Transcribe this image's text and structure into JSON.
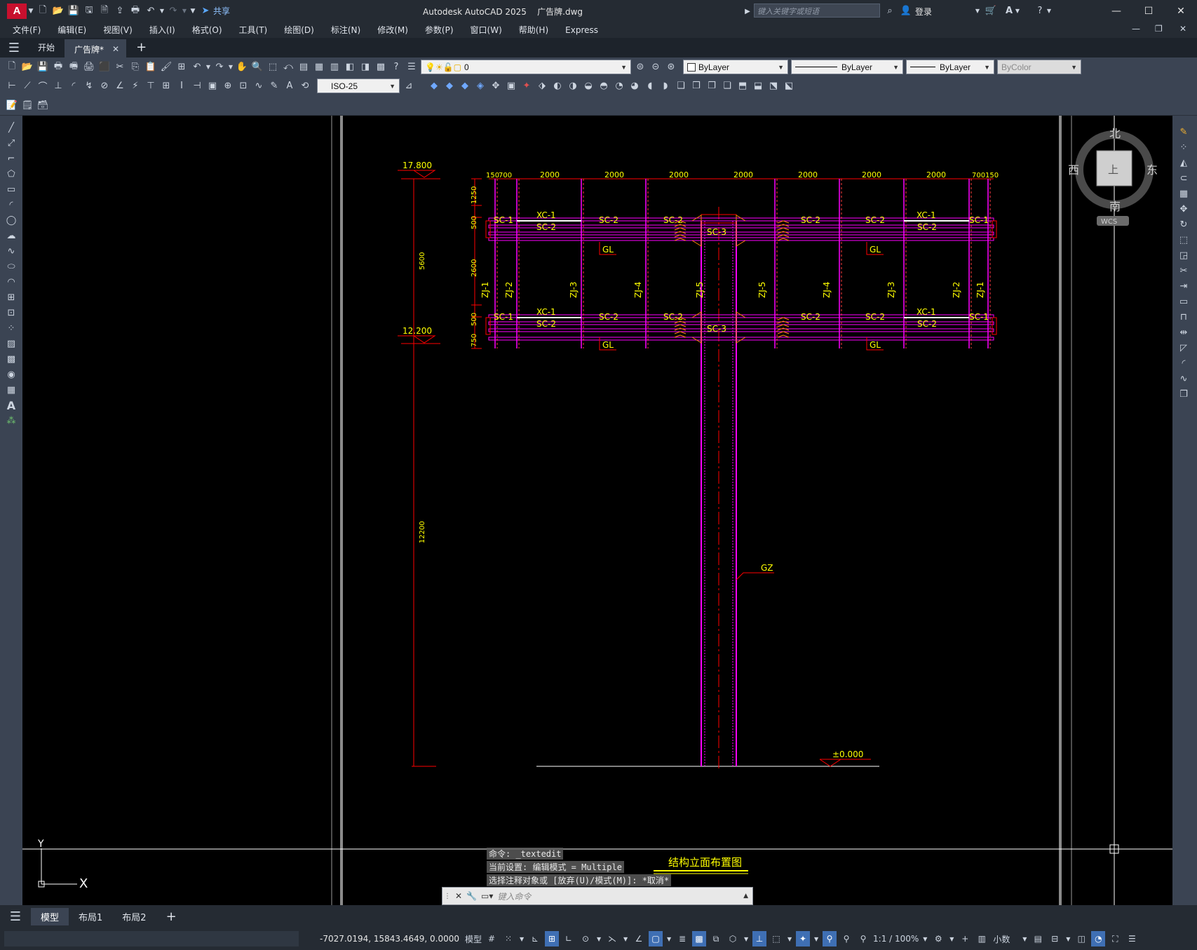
{
  "titlebar": {
    "app_logo": "A",
    "share": "共享",
    "title": "Autodesk AutoCAD 2025    广告牌.dwg",
    "search_placeholder": "键入关键字或短语",
    "login": "登录"
  },
  "menu": [
    "文件(F)",
    "编辑(E)",
    "视图(V)",
    "插入(I)",
    "格式(O)",
    "工具(T)",
    "绘图(D)",
    "标注(N)",
    "修改(M)",
    "参数(P)",
    "窗口(W)",
    "帮助(H)",
    "Express"
  ],
  "tabs": {
    "start": "开始",
    "file": "广告牌*",
    "add": "+"
  },
  "toolbars": {
    "layer": "0",
    "color": "ByLayer",
    "linetype": "ByLayer",
    "lineweight": "ByLayer",
    "plotstyle": "ByColor",
    "dimstyle": "ISO-25"
  },
  "viewcube": {
    "north": "北",
    "south": "南",
    "east": "东",
    "west": "西",
    "face": "上",
    "wcs": "WCS"
  },
  "drawing": {
    "elev_top": "17.800",
    "elev_mid": "12.200",
    "elev_ground": "±0.000",
    "dims_top": [
      "150",
      "700",
      "2000",
      "2000",
      "2000",
      "2000",
      "2000",
      "2000",
      "2000",
      "700",
      "150"
    ],
    "dims_left": [
      "1250",
      "500",
      "2600",
      "500",
      "750"
    ],
    "dims_far_left": [
      "5600",
      "12200"
    ],
    "sc1": "SC-1",
    "sc2": "SC-2",
    "sc3": "SC-3",
    "xc1": "XC-1",
    "zj": [
      "ZJ-1",
      "ZJ-2",
      "ZJ-3",
      "ZJ-4",
      "ZJ-5",
      "ZJ-5",
      "ZJ-4",
      "ZJ-3",
      "ZJ-2",
      "ZJ-1"
    ],
    "gl": "GL",
    "gz": "GZ",
    "caption": "结构立面布置图",
    "ucs_x": "X",
    "ucs_y": "Y"
  },
  "command": {
    "history": [
      "命令: _textedit",
      "当前设置: 编辑模式 = Multiple",
      "选择注释对象或 [放弃(U)/模式(M)]: *取消*"
    ],
    "placeholder": "键入命令"
  },
  "layouts": [
    "模型",
    "布局1",
    "布局2"
  ],
  "status": {
    "coords": "-7027.0194, 15843.4649, 0.0000",
    "model": "模型",
    "scale": "1:1 / 100%",
    "units": "小数"
  }
}
